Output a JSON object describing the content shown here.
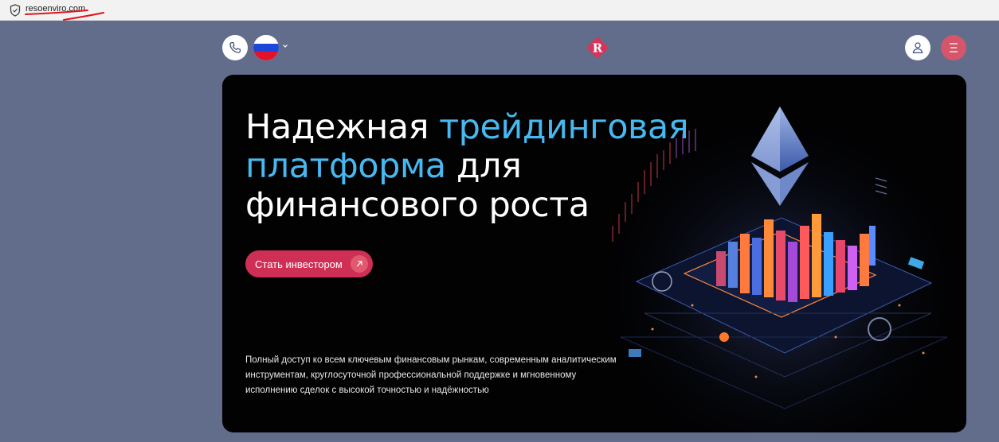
{
  "browser": {
    "url": "resoenviro.com"
  },
  "header": {
    "phone_icon": "phone-icon",
    "language_flag": "russia-flag",
    "logo_icon": "reso-r-logo",
    "user_icon": "user-icon",
    "menu_icon": "menu-icon",
    "colors": {
      "menu_button": "#d5556a",
      "background": "#626d8c"
    }
  },
  "hero": {
    "title_part1": "Надежная ",
    "title_accent1": "трейдинговая",
    "title_accent2": "платформа",
    "title_part2": " для",
    "title_line3": "финансового роста",
    "cta_label": "Стать инвестором",
    "description": "Полный доступ ко всем ключевым финансовым рынкам, современным аналитическим инструментам, круглосуточной профессиональной поддержке и мгновенному исполнению сделок с высокой точностью и надёжностью",
    "colors": {
      "accent": "#48b8f0",
      "cta": "#cf2f55"
    }
  }
}
